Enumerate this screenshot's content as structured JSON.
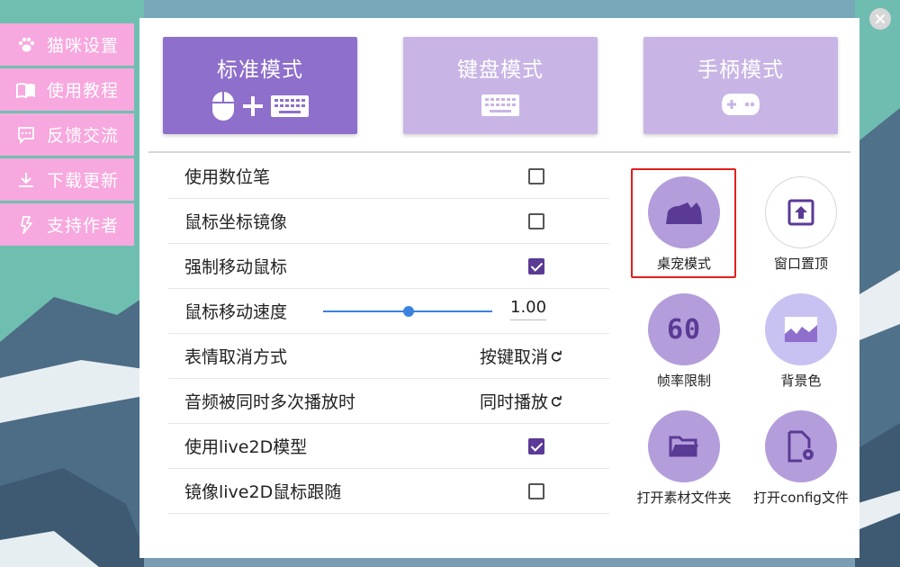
{
  "sidebar": {
    "items": [
      {
        "label": "猫咪设置",
        "icon": "paw-icon"
      },
      {
        "label": "使用教程",
        "icon": "book-icon"
      },
      {
        "label": "反馈交流",
        "icon": "chat-icon"
      },
      {
        "label": "下载更新",
        "icon": "download-icon"
      },
      {
        "label": "支持作者",
        "icon": "lightning-icon"
      }
    ]
  },
  "modes": [
    {
      "label": "标准模式",
      "active": true,
      "icons": [
        "mouse-icon",
        "plus-icon",
        "keyboard-icon"
      ]
    },
    {
      "label": "键盘模式",
      "active": false,
      "icons": [
        "keyboard-icon"
      ]
    },
    {
      "label": "手柄模式",
      "active": false,
      "icons": [
        "gamepad-icon"
      ]
    }
  ],
  "settings": {
    "digital_pen": {
      "label": "使用数位笔",
      "checked": false
    },
    "mirror_mouse": {
      "label": "鼠标坐标镜像",
      "checked": false
    },
    "force_move": {
      "label": "强制移动鼠标",
      "checked": true
    },
    "mouse_speed": {
      "label": "鼠标移动速度",
      "value": "1.00",
      "fraction": 0.5
    },
    "emoji_cancel": {
      "label": "表情取消方式",
      "option": "按键取消"
    },
    "audio_repeat": {
      "label": "音频被同时多次播放时",
      "option": "同时播放"
    },
    "use_live2d": {
      "label": "使用live2D模型",
      "checked": true
    },
    "mirror_live2d": {
      "label": "镜像live2D鼠标跟随",
      "checked": false
    }
  },
  "features": {
    "pet_mode": {
      "label": "桌宠模式",
      "icon": "cat-icon",
      "color": "#b39ddb",
      "selected": true
    },
    "pin_window": {
      "label": "窗口置顶",
      "icon": "pin-top-icon",
      "color": "#ffffff"
    },
    "frame_limit": {
      "label": "帧率限制",
      "icon": "fps-60-icon",
      "color": "#b39ddb",
      "fps_text": "60"
    },
    "bg_color": {
      "label": "背景色",
      "icon": "image-icon",
      "color": "#c7c2f2"
    },
    "open_assets": {
      "label": "打开素材文件夹",
      "icon": "folder-icon",
      "color": "#b39ddb"
    },
    "open_config": {
      "label": "打开config文件",
      "icon": "config-file-icon",
      "color": "#b39ddb"
    }
  },
  "colors": {
    "accent": "#8e6fcb",
    "accent_dark": "#5b3a96",
    "sidebar": "#f7a8de",
    "highlight": "#e0201e"
  }
}
